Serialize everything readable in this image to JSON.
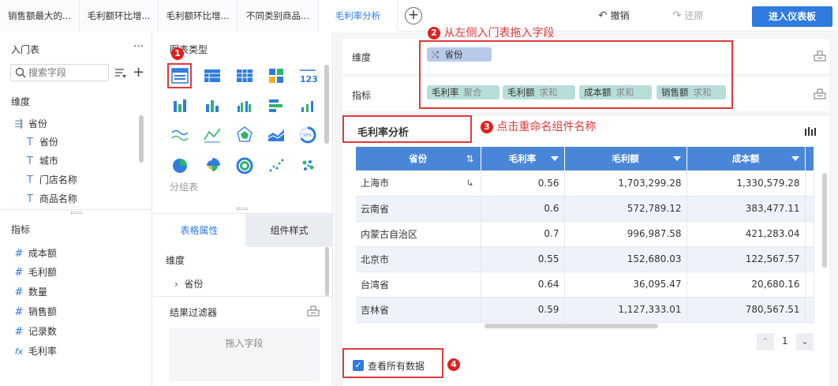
{
  "tabs": [
    "销售额最大的...",
    "毛利额环比增...",
    "毛利额环比增...",
    "不同类别商品...",
    "毛利率分析"
  ],
  "toolbar": {
    "undo": "撤销",
    "redo": "还原",
    "enter": "进入仪表板"
  },
  "left": {
    "table_name": "入门表",
    "more": "···",
    "search_placeholder": "搜索字段",
    "dim_title": "维度",
    "dims": [
      "省份",
      "省份",
      "城市",
      "门店名称",
      "商品名称"
    ],
    "measure_title": "指标",
    "measures": [
      "成本额",
      "毛利额",
      "数量",
      "销售额",
      "记录数",
      "毛利率"
    ]
  },
  "mid": {
    "chart_type_title": "图表类型",
    "group_label": "分组表",
    "tab_props": "表格属性",
    "tab_style": "组件样式",
    "dim_label": "维度",
    "dim_item": "省份",
    "filter_label": "结果过滤器",
    "drop_hint": "拖入字段"
  },
  "wells": {
    "dim_label": "维度",
    "dim_pill": "省份",
    "measure_label": "指标",
    "measure_pills": [
      {
        "name": "毛利率",
        "agg": "聚合"
      },
      {
        "name": "毛利额",
        "agg": "求和"
      },
      {
        "name": "成本额",
        "agg": "求和"
      },
      {
        "name": "销售额",
        "agg": "求和"
      }
    ]
  },
  "widget": {
    "title": "毛利率分析"
  },
  "table": {
    "headers": [
      "省份",
      "毛利率",
      "毛利额",
      "成本额"
    ],
    "rows": [
      [
        "上海市",
        "0.56",
        "1,703,299.28",
        "1,330,579.28"
      ],
      [
        "云南省",
        "0.6",
        "572,789.12",
        "383,477.11"
      ],
      [
        "内蒙古自治区",
        "0.7",
        "996,987.58",
        "421,283.04"
      ],
      [
        "北京市",
        "0.55",
        "152,680.03",
        "122,567.57"
      ],
      [
        "台湾省",
        "0.64",
        "36,095.47",
        "20,680.16"
      ],
      [
        "吉林省",
        "0.59",
        "1,127,333.01",
        "780,567.51"
      ]
    ],
    "page": "1"
  },
  "view_all": "查看所有数据",
  "annotations": [
    {
      "num": "1"
    },
    {
      "num": "2",
      "text": "从左侧入门表拖入字段"
    },
    {
      "num": "3",
      "text": "点击重命名组件名称"
    },
    {
      "num": "4"
    }
  ],
  "colors": {
    "accent": "#2f7be0",
    "header": "#4a86d8",
    "pill": "#b7ddd9",
    "dim_pill": "#b8c9ea",
    "annotation": "#e03a3a"
  }
}
